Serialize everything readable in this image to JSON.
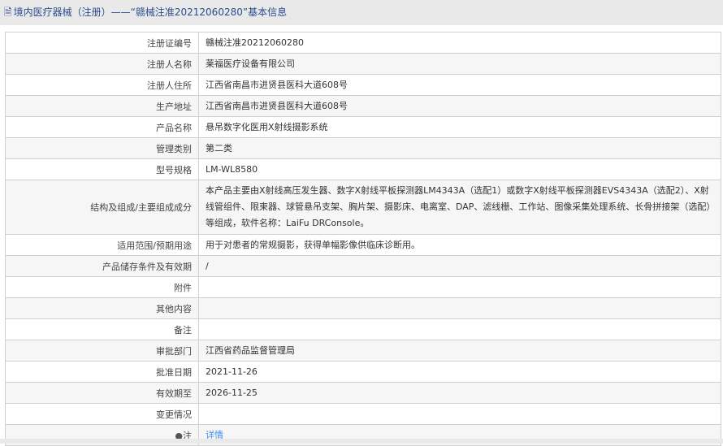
{
  "header": {
    "icon": "document-icon",
    "title": "境内医疗器械（注册）——“赣械注准20212060280”基本信息"
  },
  "rows": [
    {
      "label": "注册证编号",
      "value": "赣械注准20212060280"
    },
    {
      "label": "注册人名称",
      "value": "莱福医疗设备有限公司"
    },
    {
      "label": "注册人住所",
      "value": "江西省南昌市进贤县医科大道608号"
    },
    {
      "label": "生产地址",
      "value": "江西省南昌市进贤县医科大道608号"
    },
    {
      "label": "产品名称",
      "value": "悬吊数字化医用X射线摄影系统"
    },
    {
      "label": "管理类别",
      "value": "第二类"
    },
    {
      "label": "型号规格",
      "value": "LM-WL8580"
    },
    {
      "label": "结构及组成/主要组成成分",
      "value": "本产品主要由X射线高压发生器、数字X射线平板探测器LM4343A（选配1）或数字X射线平板探测器EVS4343A（选配2）、X射线管组件、限束器、球管悬吊支架、胸片架、摄影床、电离室、DAP、滤线栅、工作站、图像采集处理系统、长骨拼接架（选配）等组成，软件名称：LaiFu DRConsole。"
    },
    {
      "label": "适用范围/预期用途",
      "value": "用于对患者的常规摄影，获得单幅影像供临床诊断用。"
    },
    {
      "label": "产品储存条件及有效期",
      "value": "/"
    },
    {
      "label": "附件",
      "value": ""
    },
    {
      "label": "其他内容",
      "value": ""
    },
    {
      "label": "备注",
      "value": ""
    },
    {
      "label": "审批部门",
      "value": "江西省药品监督管理局"
    },
    {
      "label": "批准日期",
      "value": "2021-11-26"
    },
    {
      "label": "有效期至",
      "value": "2026-11-25"
    },
    {
      "label": "变更情况",
      "value": ""
    }
  ],
  "note": {
    "icon": "pin-icon",
    "label": "注",
    "link": "详情"
  }
}
